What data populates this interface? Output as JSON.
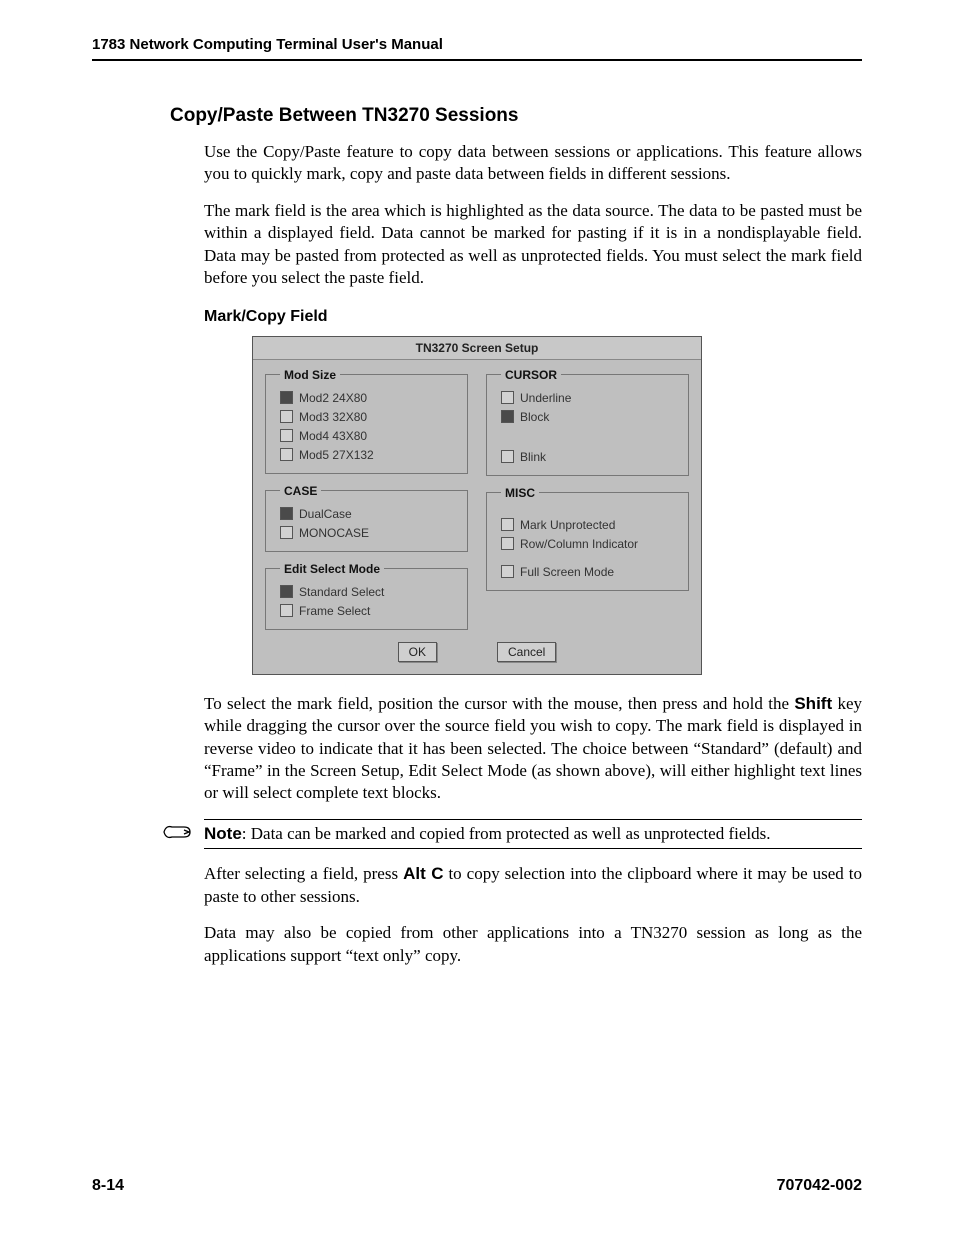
{
  "header": {
    "running_head": "1783 Network Computing Terminal User's Manual"
  },
  "section": {
    "title": "Copy/Paste Between TN3270 Sessions",
    "para1": "Use the Copy/Paste feature to copy data between sessions or applications. This feature allows you to quickly mark, copy and paste data between fields in different sessions.",
    "para2": "The mark field is the area which is highlighted as the data source. The data to be pasted must be within a displayed field. Data cannot be marked for pasting if it is in a nondisplayable field. Data may be pasted from protected as well as unprotected fields. You must select the mark field before you select the paste field.",
    "subheading": "Mark/Copy Field"
  },
  "dialog": {
    "title": "TN3270 Screen Setup",
    "groups": {
      "mod_size": {
        "legend": "Mod Size",
        "options": [
          {
            "label": "Mod2 24X80",
            "checked": true
          },
          {
            "label": "Mod3 32X80",
            "checked": false
          },
          {
            "label": "Mod4 43X80",
            "checked": false
          },
          {
            "label": "Mod5 27X132",
            "checked": false
          }
        ]
      },
      "case": {
        "legend": "CASE",
        "options": [
          {
            "label": "DualCase",
            "checked": true
          },
          {
            "label": "MONOCASE",
            "checked": false
          }
        ]
      },
      "edit_select": {
        "legend": "Edit Select Mode",
        "options": [
          {
            "label": "Standard Select",
            "checked": true
          },
          {
            "label": "Frame Select",
            "checked": false
          }
        ]
      },
      "cursor": {
        "legend": "CURSOR",
        "options": [
          {
            "label": "Underline",
            "checked": false
          },
          {
            "label": "Block",
            "checked": true
          },
          {
            "label": "Blink",
            "checked": false
          }
        ]
      },
      "misc": {
        "legend": "MISC",
        "options": [
          {
            "label": "Mark Unprotected",
            "checked": false
          },
          {
            "label": "Row/Column Indicator",
            "checked": false
          },
          {
            "label": "Full Screen Mode",
            "checked": false
          }
        ]
      }
    },
    "buttons": {
      "ok": "OK",
      "cancel": "Cancel"
    }
  },
  "after": {
    "para3_a": "To select the mark field, position the cursor with the mouse, then press and hold the ",
    "para3_shift": "Shift",
    "para3_b": " key while dragging the cursor over the source field you wish to copy. The mark field is displayed in reverse video to indicate that it has been selected. The choice between “Standard” (default) and “Frame” in the Screen Setup, Edit Select Mode (as shown above), will either highlight text lines or will select complete text blocks.",
    "note_label": "Note",
    "note_text": ": Data can be marked and copied from protected as well as unprotected fields.",
    "para4_a": "After selecting a field, press ",
    "para4_altc": "Alt C",
    "para4_b": " to copy selection into the clipboard where it may be used to paste to other sessions.",
    "para5": "Data may also be copied from other applications into a TN3270 session as long as the applications support “text only” copy."
  },
  "footer": {
    "page": "8-14",
    "doc": "707042-002"
  }
}
